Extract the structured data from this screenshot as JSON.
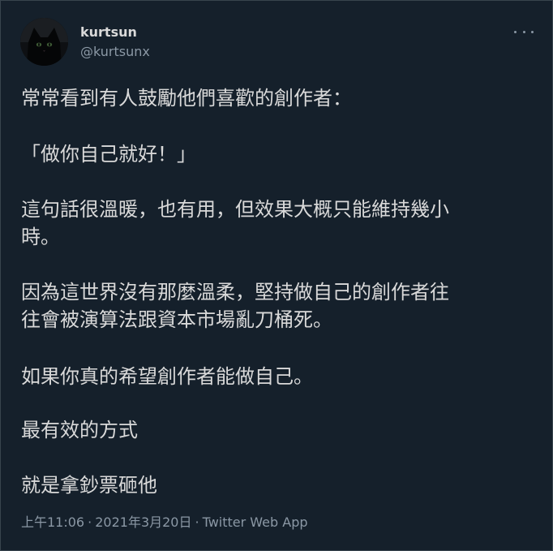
{
  "author": {
    "display_name": "kurtsun",
    "handle": "@kurtsunx",
    "avatar_icon": "black-cat-avatar"
  },
  "more_icon": "more-options-icon",
  "tweet": {
    "lines": [
      "常常看到有人鼓勵他們喜歡的創作者：",
      "「做你自己就好！」",
      "這句話很溫暖，也有用，但效果大概只能維持幾小",
      "時。",
      "因為這世界沒有那麼溫柔，堅持做自己的創作者往",
      "往會被演算法跟資本市場亂刀桶死。",
      "如果你真的希望創作者能做自己。",
      "最有效的方式",
      "就是拿鈔票砸他"
    ]
  },
  "meta": {
    "time": "上午11:06",
    "date": "2021年3月20日",
    "source": "Twitter Web App",
    "separator": "·"
  },
  "colors": {
    "background": "#15202b",
    "text": "#d9d9d9",
    "secondary": "#8b98a5",
    "border": "#38444d"
  }
}
